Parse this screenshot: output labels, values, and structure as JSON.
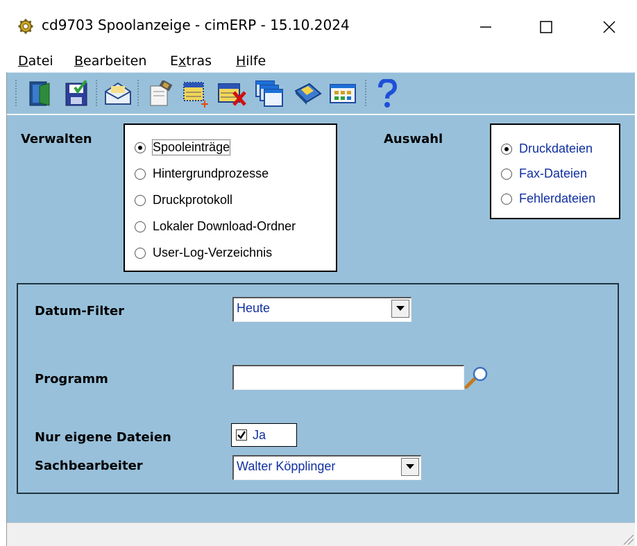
{
  "window": {
    "title": "cd9703 Spoolanzeige - cimERP - 15.10.2024"
  },
  "menu": {
    "items": [
      {
        "label": "Datei",
        "accel": "D",
        "rest": "atei"
      },
      {
        "label": "Bearbeiten",
        "accel": "B",
        "rest": "earbeiten"
      },
      {
        "label": "Extras",
        "pre": "E",
        "accel": "x",
        "rest": "tras"
      },
      {
        "label": "Hilfe",
        "accel": "H",
        "rest": "ilfe"
      }
    ]
  },
  "toolbar": {
    "buttons": [
      "exit-icon",
      "save-icon",
      "mail-icon",
      "edit-icon",
      "new-entry-icon",
      "delete-icon",
      "windows-icon",
      "book-icon",
      "grid-icon",
      "help-icon"
    ]
  },
  "verwalten": {
    "label": "Verwalten",
    "options": [
      {
        "label": "Spooleinträge",
        "checked": true
      },
      {
        "label": "Hintergrundprozesse",
        "checked": false
      },
      {
        "label": "Druckprotokoll",
        "checked": false
      },
      {
        "label": "Lokaler Download-Ordner",
        "checked": false
      },
      {
        "label": "User-Log-Verzeichnis",
        "checked": false
      }
    ]
  },
  "auswahl": {
    "label": "Auswahl",
    "options": [
      {
        "label": "Druckdateien",
        "checked": true
      },
      {
        "label": "Fax-Dateien",
        "checked": false
      },
      {
        "label": "Fehlerdateien",
        "checked": false
      }
    ]
  },
  "filter": {
    "datum_label": "Datum-Filter",
    "datum_value": "Heute",
    "programm_label": "Programm",
    "programm_value": "",
    "eigene_label": "Nur eigene Dateien",
    "eigene_value": "Ja",
    "eigene_checked": true,
    "sachbearbeiter_label": "Sachbearbeiter",
    "sachbearbeiter_value": "Walter Köpplinger"
  },
  "colors": {
    "panel_bg": "#98c0da",
    "value_blue": "#1030a0"
  }
}
